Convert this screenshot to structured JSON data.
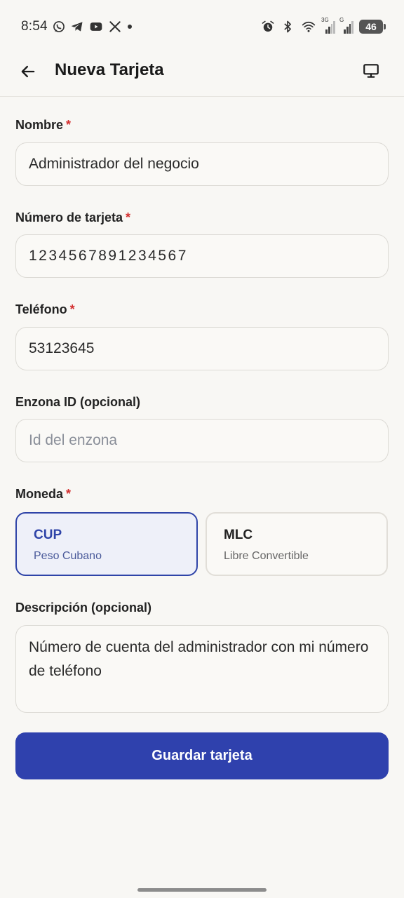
{
  "status_bar": {
    "time": "8:54",
    "battery": "46",
    "net1_label": "3G",
    "net2_label": "G"
  },
  "app_bar": {
    "title": "Nueva Tarjeta"
  },
  "form": {
    "nombre": {
      "label": "Nombre",
      "value": "Administrador del negocio"
    },
    "numero": {
      "label": "Número de tarjeta",
      "value": "1234567891234567"
    },
    "telefono": {
      "label": "Teléfono",
      "value": "53123645"
    },
    "enzona": {
      "label": "Enzona ID (opcional)",
      "placeholder": "Id del enzona"
    },
    "moneda": {
      "label": "Moneda",
      "options": [
        {
          "code": "CUP",
          "name": "Peso Cubano",
          "selected": true
        },
        {
          "code": "MLC",
          "name": "Libre Convertible",
          "selected": false
        }
      ]
    },
    "descripcion": {
      "label": "Descripción (opcional)",
      "value": "Número de cuenta del administrador con mi número de teléfono"
    },
    "required_mark": "*"
  },
  "actions": {
    "save_label": "Guardar tarjeta"
  },
  "colors": {
    "primary": "#2f41ad",
    "required": "#d32f2f",
    "background": "#f8f7f4"
  }
}
